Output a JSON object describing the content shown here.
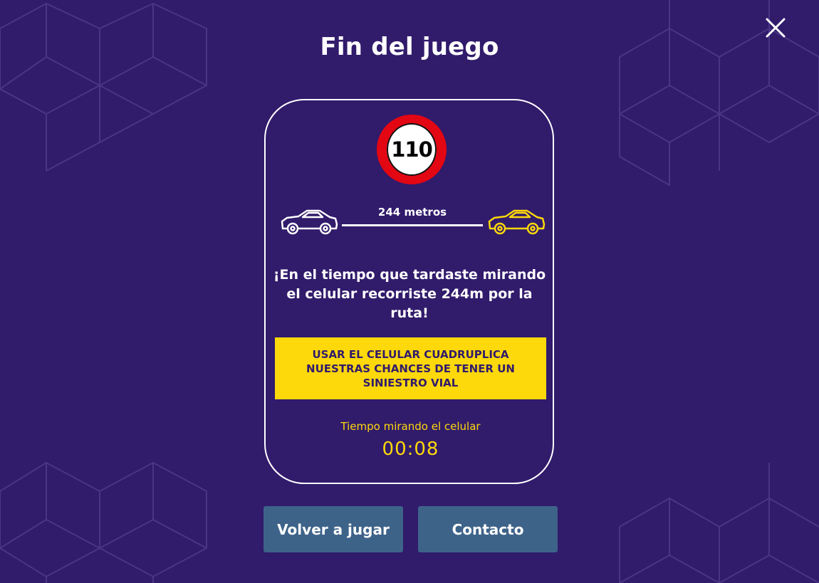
{
  "header": {
    "title": "Fin del juego"
  },
  "speed_sign": {
    "limit": "110",
    "border_color": "#e30613"
  },
  "distance": {
    "label": "244 metros"
  },
  "message": "¡En el tiempo que tardaste mirando el celular recorriste 244m por la ruta!",
  "warning": "USAR EL CELULAR CUADRUPLICA NUESTRAS CHANCES DE TENER UN SINIESTRO VIAL",
  "timer": {
    "label": "Tiempo mirando el celular",
    "value": "00:08"
  },
  "buttons": {
    "replay_label": "Volver a jugar",
    "contact_label": "Contacto"
  },
  "colors": {
    "background": "#311b6b",
    "accent_yellow": "#fdd80b",
    "button": "#3e6389"
  },
  "icons": {
    "close": "close-icon",
    "own_car": "car-outline-white-icon",
    "other_car": "car-outline-yellow-icon"
  }
}
